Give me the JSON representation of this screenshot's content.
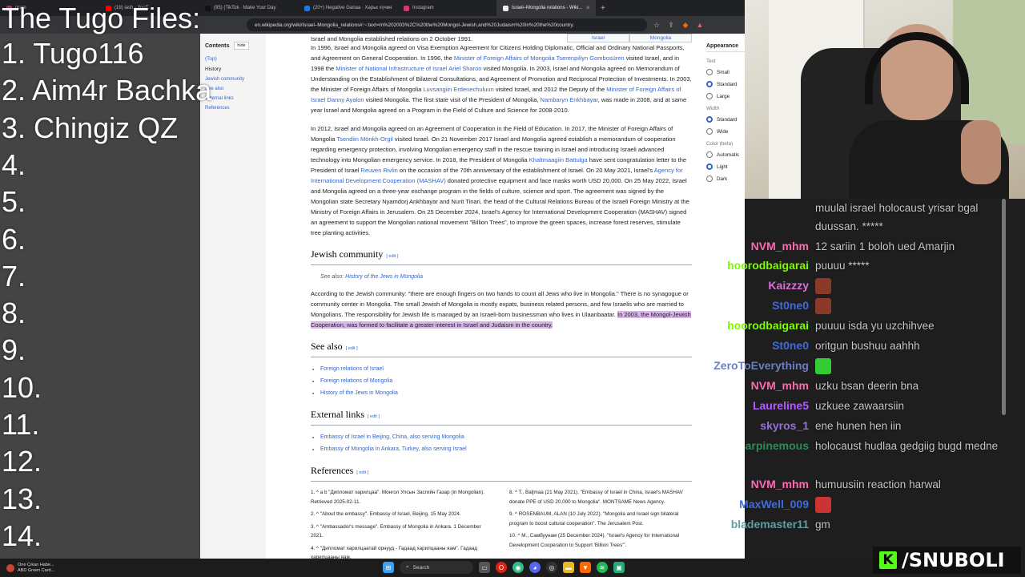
{
  "browser": {
    "tabs": [
      {
        "label": "gram",
        "color": "#c13584"
      },
      {
        "label": "(19) iash - YouT...",
        "color": "#ff0000"
      },
      {
        "label": "(95) (TikTok · Make Your Day",
        "color": "#111111"
      },
      {
        "label": "(20+) Negative Ganaa · Харьк хүчин",
        "color": "#1877f2"
      },
      {
        "label": "Instagram",
        "color": "#e1306c"
      },
      {
        "label": "Israel–Mongolia relations - Wiki...",
        "color": "#eeeeee"
      }
    ],
    "url": "en.wikipedia.org/wiki/Israel–Mongolia_relations#:~:text=In%202003%2C%20the%20Mongol-Jewish,and%20Judaism%20in%20the%20country."
  },
  "overlay": {
    "title": "The Tugo Files:",
    "lines": [
      "1. Tugo116",
      "2. Aim4r Bachka",
      "3. Chingiz QZ",
      "4.",
      "5.",
      "6.",
      "7.",
      "8.",
      "9.",
      "10.",
      "11.",
      "12.",
      "13.",
      "14."
    ]
  },
  "toc": {
    "heading": "Contents",
    "hide": "hide",
    "items": [
      "(Top)",
      "History",
      "Jewish community",
      "See also",
      "External links",
      "References"
    ]
  },
  "article": {
    "lang_left": "Israel",
    "lang_right": "Mongolia",
    "p1_a": "Israel and Mongolia established relations on 2 October 1991.",
    "p1_b": " In 1996, Israel and Mongolia agreed on Visa Exemption Agreement for Citizens Holding Diplomatic, Official and Ordinary National Passports, and Agreement on General Cooperation. In 1996, the ",
    "p1_link1": "Minister of Foreign Affairs of Mongolia Tserenpiliyn Gombosüren",
    "p1_c": " visited Israel, and in 1998 the ",
    "p1_link2": "Minister of National Infrastructure of Israel Ariel Sharon",
    "p1_d": " visited Mongolia. In 2003, Israel and Mongolia agreed on Memorandum of Understanding on the Establishment of Bilateral Consultations, and Agreement of Promotion and Reciprocal Protection of Investments. In 2003, the Minister of Foreign Affairs of Mongolia ",
    "p1_link3": "Luvsangiin Erdenechuluun",
    "p1_e": " visited Israel, and 2012 the Deputy of the ",
    "p1_link4": "Minister of Foreign Affairs of Israel Danny Ayalon",
    "p1_f": " visited Mongolia. The first state visit of the President of Mongolia, ",
    "p1_link5": "Nambaryn Enkhbayar",
    "p1_g": ", was made in 2008, and at same year Israel and Mongolia agreed on a Program in the Field of Culture and Science for 2008-2010.",
    "p2_a": "In 2012, Israel and Mongolia agreed on an Agreement of Cooperation in the Field of Education. In 2017, the Minister of Foreign Affairs of Mongolia ",
    "p2_link1": "Tsendiin Mönkh-Orgil",
    "p2_b": " visited Israel. On 21 November 2017 Israel and Mongolia agreed establish a memorandum of cooperation regarding emergency protection, involving Mongolian emergency staff in the rescue training in Israel and introducing Israeli advanced technology into Mongolian emergency service. In 2018, the President of Mongolia ",
    "p2_link2": "Khaltmaagiin Battulga",
    "p2_c": " have sent congratulation letter to the President of Israel ",
    "p2_link3": "Reuven Rivlin",
    "p2_d": " on the occasion of the 70th anniversary of the establishment of Israel. On 20 May 2021, Israel's ",
    "p2_link4": "Agency for International Development Cooperation (MASHAV)",
    "p2_e": " donated protective equipment and face masks worth USD 20,000. On 25 May 2022, Israel and Mongolia agreed on a three-year exchange program in the fields of culture, science and sport. The agreement was signed by the Mongolian state Secretary Nyamdorj Ankhbayar and Nurit Tinari, the head of the Cultural Relations Bureau of the Israeli Foreign Ministry at the Ministry of Foreign Affairs in Jerusalem. On 25 December 2024, Israel's Agency for International Development Cooperation (MASHAV) signed an agreement to support the Mongolian national movement \"Billion Trees\", to improve the green spaces, increase forest reserves, stimulate tree planting activities.",
    "h_jewish": "Jewish community",
    "edit": "edit",
    "hatnote_pre": "See also: ",
    "hatnote_link": "History of the Jews in Mongolia",
    "p3_a": "According to the Jewish community: \"there are enough fingers on two hands to count all Jews who live in Mongolia.\" There is no synagogue or community center in Mongolia. The small Jewish of Mongolia is mostly expats, business related persons, and few Israelis who are married to Mongolians. The responsibility for Jewish life is managed by an Israeli-born businessman who lives in Ulaanbaatar. ",
    "p3_highlight": "In 2003, the Mongol-Jewish Cooperation, was formed to facilitate a greater interest in Israel and Judaism in the country.",
    "h_seealso": "See also",
    "seealso": [
      "Foreign relations of Israel",
      "Foreign relations of Mongolia",
      "History of the Jews in Mongolia"
    ],
    "h_external": "External links",
    "external": [
      "Embassy of Israel in Beijing, China, also serving Mongolia",
      "Embassy of Mongolia in Ankara, Turkey, also serving Israel"
    ],
    "h_refs": "References",
    "refs_left": [
      "1. ^ a b \"Дипломат харилцаа\". Монгол Улсын Засгийн Газар (in Mongolian). Retrieved 2025-02-11.",
      "2. ^ \"About the embassy\". Embassy of Israel, Beijing. 15 May 2024.",
      "3. ^ \"Ambassador's message\". Embassy of Mongolia in Ankara. 1 December 2021.",
      "4. ^ \"Дипломат харилцаатай орнууд - Гадаад харилцааны яам\". Гадаад харилцааны яам."
    ],
    "refs_right": [
      "8. ^ T., Baljmaa (21 May 2021). \"Embassy of Israel in China, Israel's MASHAV donate PPE of USD 20,000 to Mongolia\". MONTSAME News Agency.",
      "9. ^ ROSENBAUM, ALAN (10 July 2022). \"Mongolia and Israel sign bilateral program to boost cultural cooperation\". The Jerusalem Post.",
      "10. ^ M., Самбуунам (25 December 2024). \"Israel's Agency for International Development Cooperation to Support 'Billion Trees'\"."
    ]
  },
  "appearance": {
    "heading": "Appearance",
    "text_label": "Text",
    "text_opts": [
      "Small",
      "Standard",
      "Large"
    ],
    "width_label": "Width",
    "width_opts": [
      "Standard",
      "Wide"
    ],
    "color_label": "Color (beta)",
    "color_opts": [
      "Automatic",
      "Light",
      "Dark"
    ]
  },
  "chat": {
    "messages": [
      {
        "name": "",
        "color": "#ffffff",
        "text": "muulal israel holocaust yrisar bgal duussan. *****"
      },
      {
        "name": "NVM_mhm",
        "color": "#ff69b4",
        "text": "12 sariin 1 boloh ued Amarjin"
      },
      {
        "name": "hoorodbaigarai",
        "color": "#7cfc00",
        "text": "puuuu *****"
      },
      {
        "name": "Kaizzzy",
        "color": "#da70d6",
        "text": ""
      },
      {
        "name": "St0ne0",
        "color": "#4169e1",
        "text": ""
      },
      {
        "name": "hoorodbaigarai",
        "color": "#7cfc00",
        "text": "puuuu isda yu uzchihvee"
      },
      {
        "name": "St0ne0",
        "color": "#4169e1",
        "text": "oritgun bushuu aahhh"
      },
      {
        "name": "ZeroToEverything",
        "color": "#6a7fbf",
        "text": ""
      },
      {
        "name": "NVM_mhm",
        "color": "#ff69b4",
        "text": "uzku bsan deerin bna"
      },
      {
        "name": "Laureline5",
        "color": "#b05cff",
        "text": "uzkuee zawaarsiin"
      },
      {
        "name": "skyros_1",
        "color": "#9370db",
        "text": "ene hunen hen iin"
      },
      {
        "name": "arpinemous",
        "color": "#2e8b57",
        "text": "holocaust hudlaa gedgiig bugd medne"
      },
      {
        "name": "NVM_mhm",
        "color": "#ff69b4",
        "text": "humuusiin reaction harwal"
      },
      {
        "name": "MaxWell_009",
        "color": "#4169e1",
        "text": ""
      },
      {
        "name": "blademaster11",
        "color": "#5f9ea0",
        "text": "gm"
      }
    ]
  },
  "badge": {
    "text": "/SNUBOLI"
  },
  "taskbar": {
    "news_title": "One Çıkan Habe...",
    "news_sub": "ABD Green Card...",
    "search": "Search"
  }
}
